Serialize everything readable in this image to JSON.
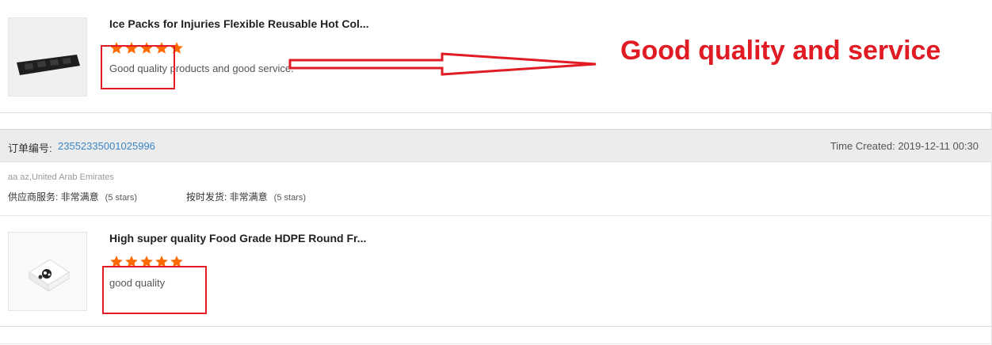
{
  "reviews": [
    {
      "title": "Ice Packs for Injuries Flexible Reusable Hot Col...",
      "rating": 5,
      "comment": "Good quality products and good service."
    },
    {
      "title": "High super quality Food Grade HDPE Round Fr...",
      "rating": 5,
      "comment": "good quality"
    }
  ],
  "order": {
    "label": "订单编号:",
    "number": "23552335001025996",
    "time_created": "Time Created: 2019-12-11 00:30"
  },
  "buyer": "aa az,United Arab Emirates",
  "ratings": {
    "supplier_label": "供应商服务: 非常满意",
    "supplier_stars": "(5 stars)",
    "delivery_label": "按时发货: 非常满意",
    "delivery_stars": "(5 stars)"
  },
  "annotation": "Good quality and service",
  "colors": {
    "star": "#ff6a00",
    "annotation_red": "#e01b24",
    "link_blue": "#3a86c8"
  }
}
